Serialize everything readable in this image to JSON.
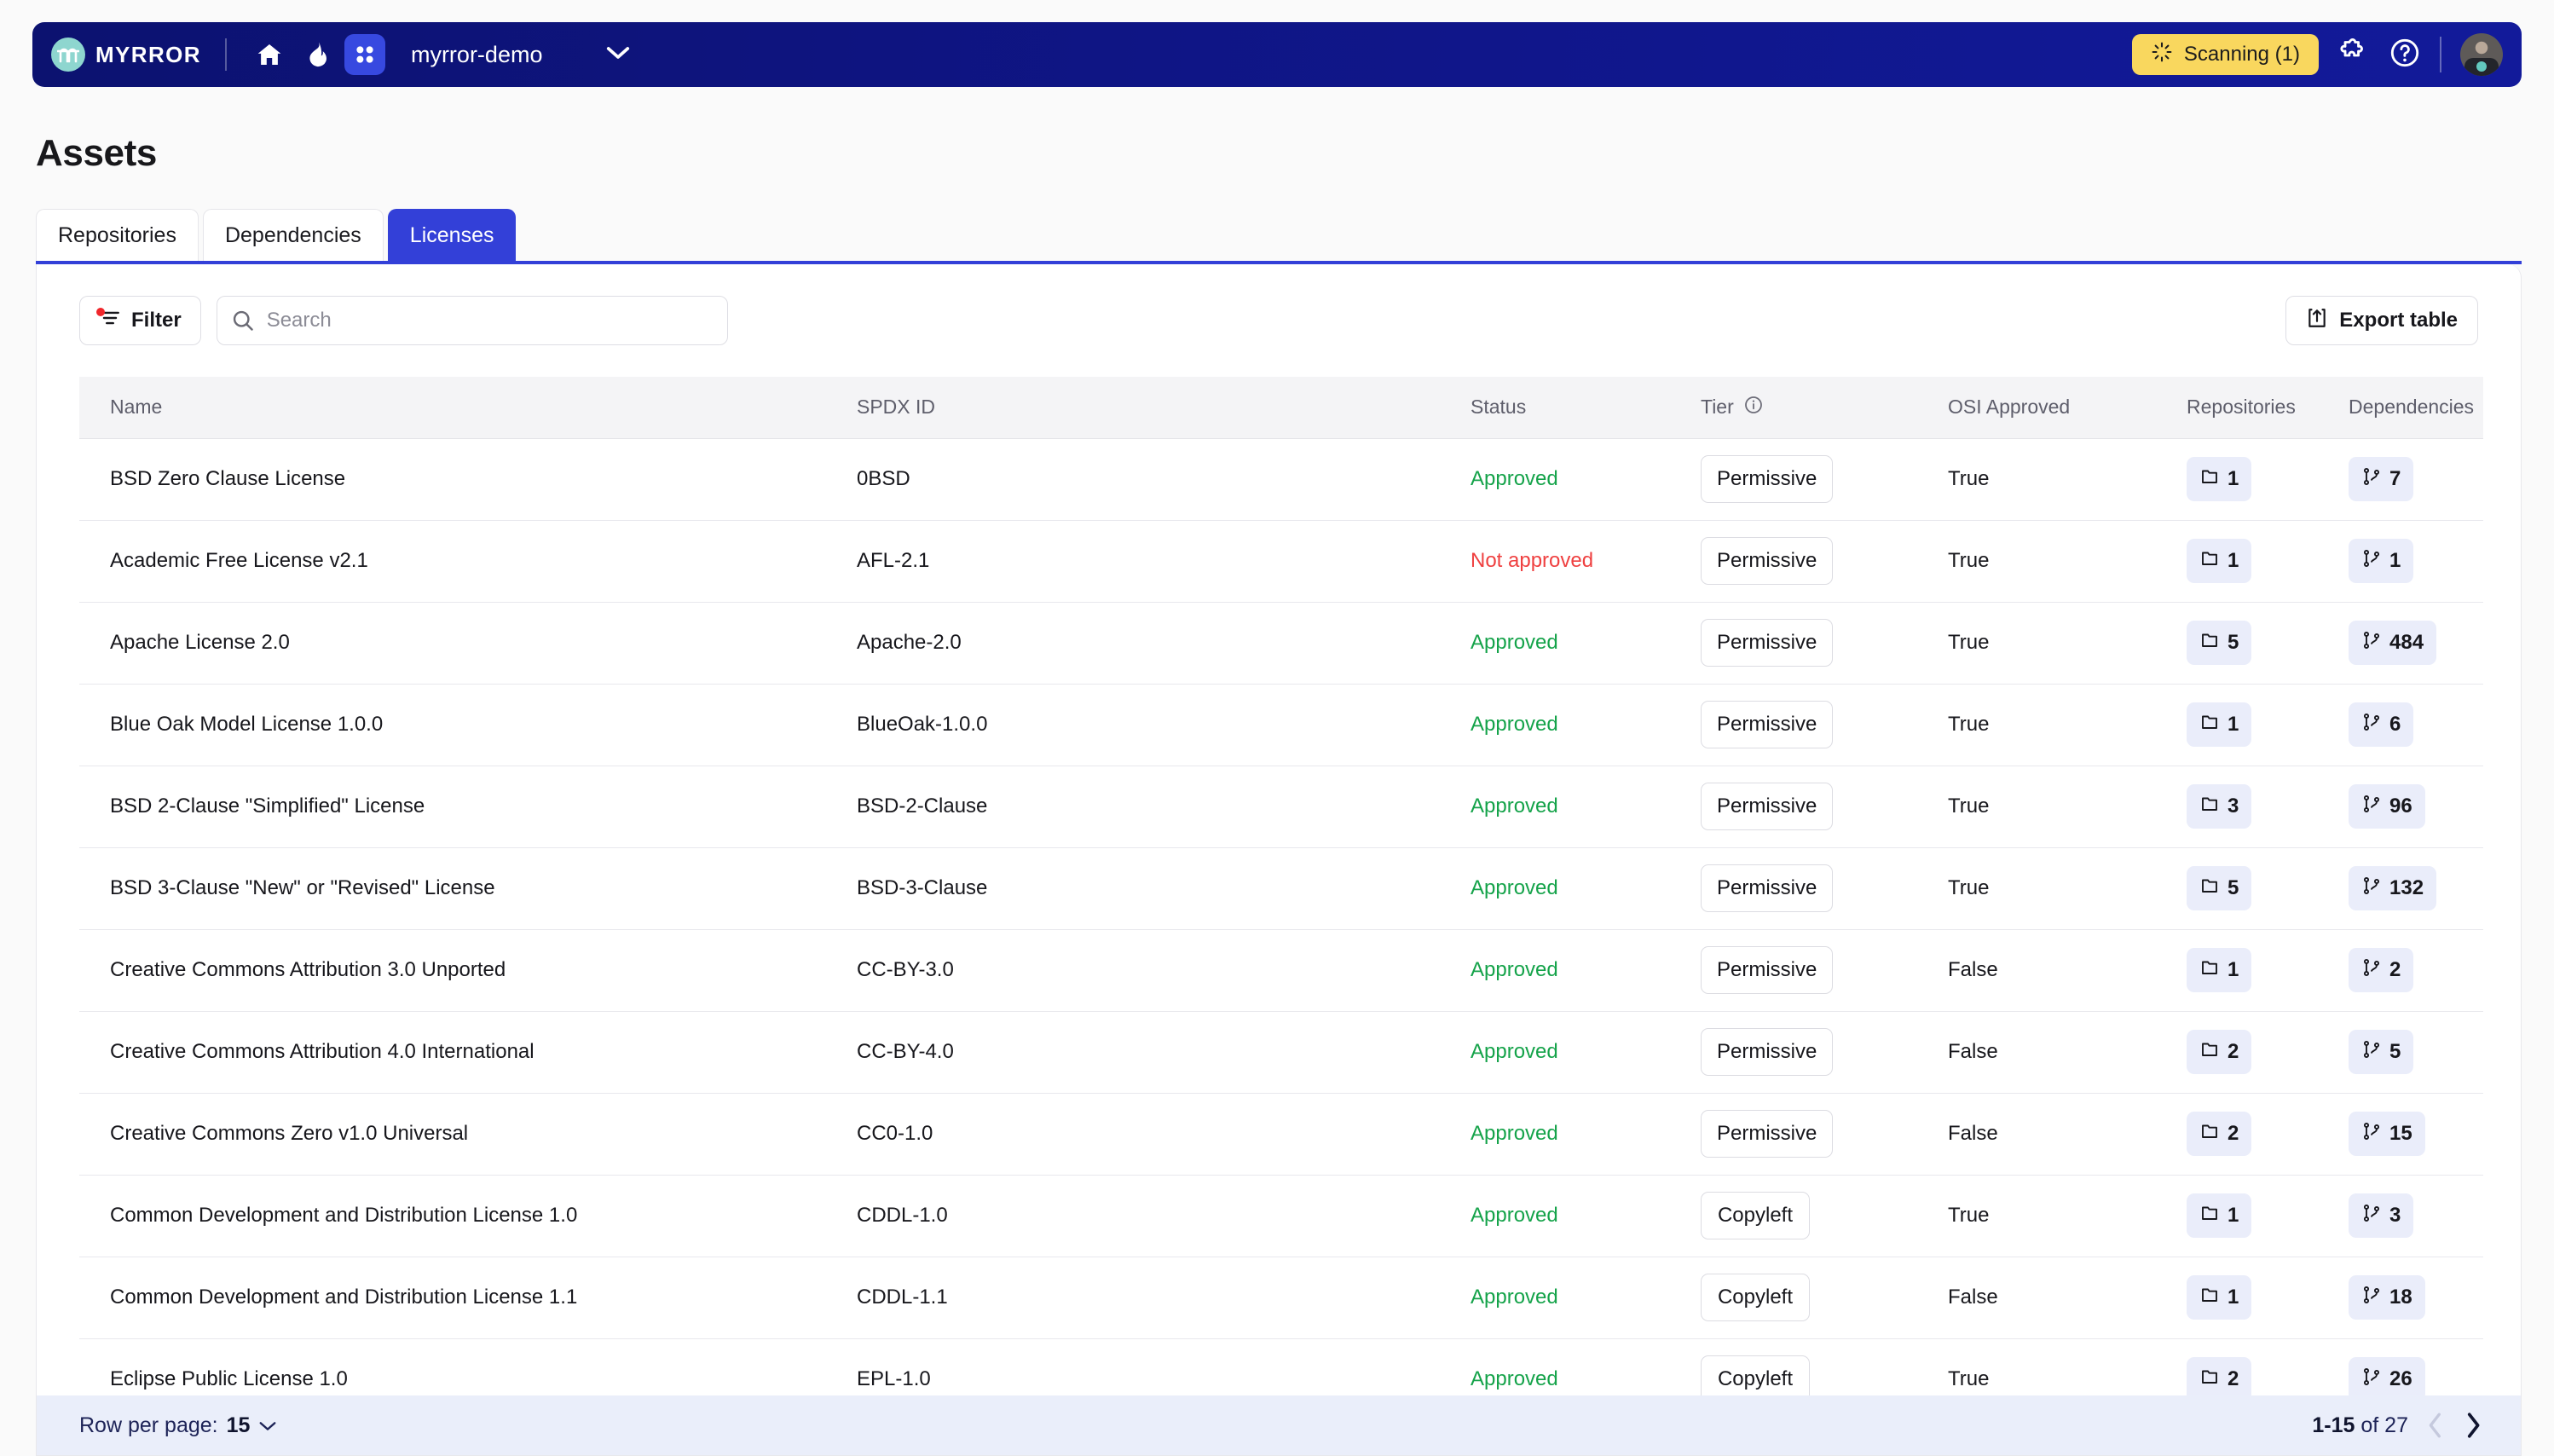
{
  "topnav": {
    "brand_name": "MYRROR",
    "brand_icon": "myrror-logo-icon",
    "nav_icons": [
      {
        "name": "home-icon",
        "active": false
      },
      {
        "name": "flame-icon",
        "active": false
      },
      {
        "name": "grid-apps-icon",
        "active": true
      }
    ],
    "project": "myrror-demo",
    "project_chevron": "chevron-down-icon",
    "scanning_label": "Scanning (1)",
    "scanning_icon": "spinner-icon",
    "scanning_color": "#f9d75e",
    "integrations_icon": "puzzle-piece-icon",
    "help_icon": "question-circle-icon",
    "avatar": "user-avatar"
  },
  "page": {
    "title": "Assets"
  },
  "tabs": [
    {
      "label": "Repositories",
      "active": false
    },
    {
      "label": "Dependencies",
      "active": false
    },
    {
      "label": "Licenses",
      "active": true
    }
  ],
  "toolbar": {
    "filter_label": "Filter",
    "filter_icon": "filter-icon",
    "filter_has_indicator": true,
    "search_placeholder": "Search",
    "search_value": "",
    "search_icon": "search-icon",
    "export_label": "Export table",
    "export_icon": "export-upload-icon"
  },
  "table": {
    "columns": [
      {
        "key": "name",
        "label": "Name"
      },
      {
        "key": "spdx",
        "label": "SPDX ID"
      },
      {
        "key": "status",
        "label": "Status"
      },
      {
        "key": "tier",
        "label": "Tier",
        "info_icon": "info-circle-icon"
      },
      {
        "key": "osi",
        "label": "OSI Approved"
      },
      {
        "key": "repos",
        "label": "Repositories"
      },
      {
        "key": "deps",
        "label": "Dependencies"
      }
    ],
    "repos_icon": "folder-icon",
    "deps_icon": "git-branch-icon",
    "rows": [
      {
        "name": "BSD Zero Clause License",
        "spdx": "0BSD",
        "status": "Approved",
        "status_state": "approved",
        "tier": "Permissive",
        "osi": "True",
        "repos": "1",
        "deps": "7"
      },
      {
        "name": "Academic Free License v2.1",
        "spdx": "AFL-2.1",
        "status": "Not approved",
        "status_state": "not-approved",
        "tier": "Permissive",
        "osi": "True",
        "repos": "1",
        "deps": "1"
      },
      {
        "name": "Apache License 2.0",
        "spdx": "Apache-2.0",
        "status": "Approved",
        "status_state": "approved",
        "tier": "Permissive",
        "osi": "True",
        "repos": "5",
        "deps": "484"
      },
      {
        "name": "Blue Oak Model License 1.0.0",
        "spdx": "BlueOak-1.0.0",
        "status": "Approved",
        "status_state": "approved",
        "tier": "Permissive",
        "osi": "True",
        "repos": "1",
        "deps": "6"
      },
      {
        "name": "BSD 2-Clause \"Simplified\" License",
        "spdx": "BSD-2-Clause",
        "status": "Approved",
        "status_state": "approved",
        "tier": "Permissive",
        "osi": "True",
        "repos": "3",
        "deps": "96"
      },
      {
        "name": "BSD 3-Clause \"New\" or \"Revised\" License",
        "spdx": "BSD-3-Clause",
        "status": "Approved",
        "status_state": "approved",
        "tier": "Permissive",
        "osi": "True",
        "repos": "5",
        "deps": "132"
      },
      {
        "name": "Creative Commons Attribution 3.0 Unported",
        "spdx": "CC-BY-3.0",
        "status": "Approved",
        "status_state": "approved",
        "tier": "Permissive",
        "osi": "False",
        "repos": "1",
        "deps": "2"
      },
      {
        "name": "Creative Commons Attribution 4.0 International",
        "spdx": "CC-BY-4.0",
        "status": "Approved",
        "status_state": "approved",
        "tier": "Permissive",
        "osi": "False",
        "repos": "2",
        "deps": "5"
      },
      {
        "name": "Creative Commons Zero v1.0 Universal",
        "spdx": "CC0-1.0",
        "status": "Approved",
        "status_state": "approved",
        "tier": "Permissive",
        "osi": "False",
        "repos": "2",
        "deps": "15"
      },
      {
        "name": "Common Development and Distribution License 1.0",
        "spdx": "CDDL-1.0",
        "status": "Approved",
        "status_state": "approved",
        "tier": "Copyleft",
        "osi": "True",
        "repos": "1",
        "deps": "3"
      },
      {
        "name": "Common Development and Distribution License 1.1",
        "spdx": "CDDL-1.1",
        "status": "Approved",
        "status_state": "approved",
        "tier": "Copyleft",
        "osi": "False",
        "repos": "1",
        "deps": "18"
      },
      {
        "name": "Eclipse Public License 1.0",
        "spdx": "EPL-1.0",
        "status": "Approved",
        "status_state": "approved",
        "tier": "Copyleft",
        "osi": "True",
        "repos": "2",
        "deps": "26"
      }
    ]
  },
  "footer": {
    "rows_per_page_label": "Row per page:",
    "rows_per_page_value": "15",
    "rows_per_page_chevron": "chevron-down-icon",
    "range_current": "1-15",
    "range_total": "of 27",
    "prev_icon": "chevron-left-icon",
    "next_icon": "chevron-right-icon",
    "prev_enabled": false,
    "next_enabled": true
  }
}
